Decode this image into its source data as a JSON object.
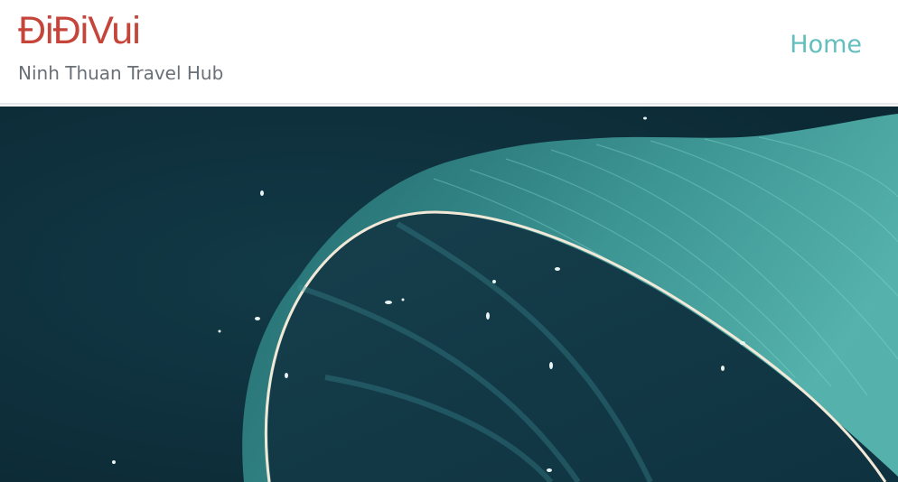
{
  "brand": {
    "logo_text": "ĐiĐiVui",
    "tagline": "Ninh Thuan Travel Hub"
  },
  "nav": {
    "home_label": "Home"
  },
  "colors": {
    "logo": "#c5453b",
    "nav_link": "#62bfbd",
    "tagline": "#6a7078",
    "hero_water": "#0d2d38",
    "hero_foam": "#5fc4bd"
  }
}
